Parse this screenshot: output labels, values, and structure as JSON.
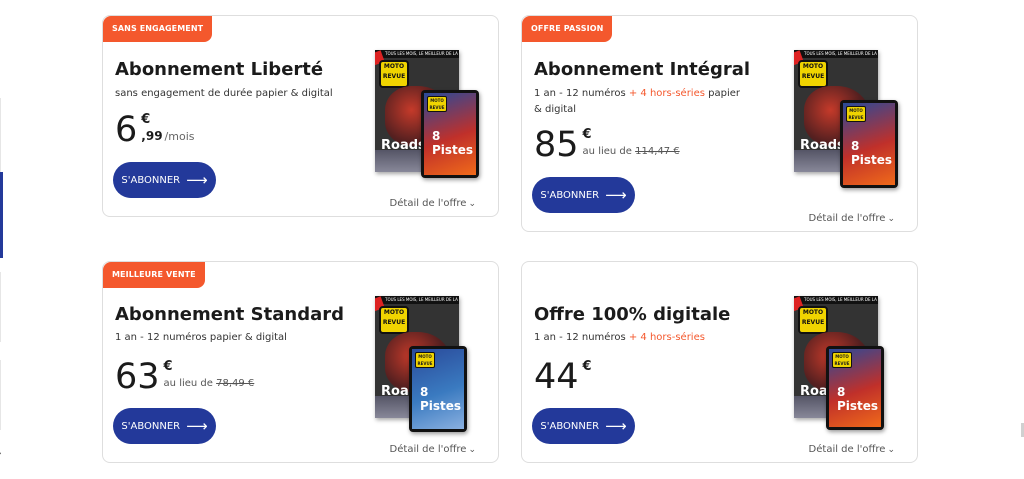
{
  "cards": [
    {
      "badge": "SANS ENGAGEMENT",
      "title": "Abonnement Liberté",
      "subtitle": "sans engagement de durée papier & digital",
      "price": "6",
      "currency": "€",
      "cents": ",99",
      "per": "/mois",
      "button": "S'ABONNER",
      "detail": "Détail de l'offre"
    },
    {
      "badge": "OFFRE PASSION",
      "title": "Abonnement Intégral",
      "subtitle_a": "1 an - 12 numéros ",
      "subtitle_hl": "+ 4 hors-séries",
      "subtitle_b": " papier & digital",
      "price": "85",
      "currency": "€",
      "was_label": "au lieu de ",
      "was_price": "114,47 €",
      "button": "S'ABONNER",
      "detail": "Détail de l'offre"
    },
    {
      "badge": "MEILLEURE VENTE",
      "title": "Abonnement Standard",
      "subtitle": "1 an - 12 numéros papier & digital",
      "price": "63",
      "currency": "€",
      "was_label": "au lieu de ",
      "was_price": "78,49 €",
      "button": "S'ABONNER",
      "detail": "Détail de l'offre"
    },
    {
      "title": "Offre 100% digitale",
      "subtitle_a": "1 an - 12 numéros ",
      "subtitle_hl": "+ 4 hors-séries",
      "price": "44",
      "currency": "€",
      "button": "S'ABONNER",
      "detail": "Détail de l'offre"
    }
  ],
  "magazine": {
    "logo": "MOTO REVUE",
    "strap": "TOUS LES MOIS, LE MEILLEUR DE LA MOTO",
    "word": "Roadst",
    "tablet_word": "8 Pistes",
    "icons": [
      "arrow-right-icon",
      "chevron-down-icon"
    ]
  },
  "colors": {
    "accent": "#23399a",
    "badge": "#f4582d"
  }
}
